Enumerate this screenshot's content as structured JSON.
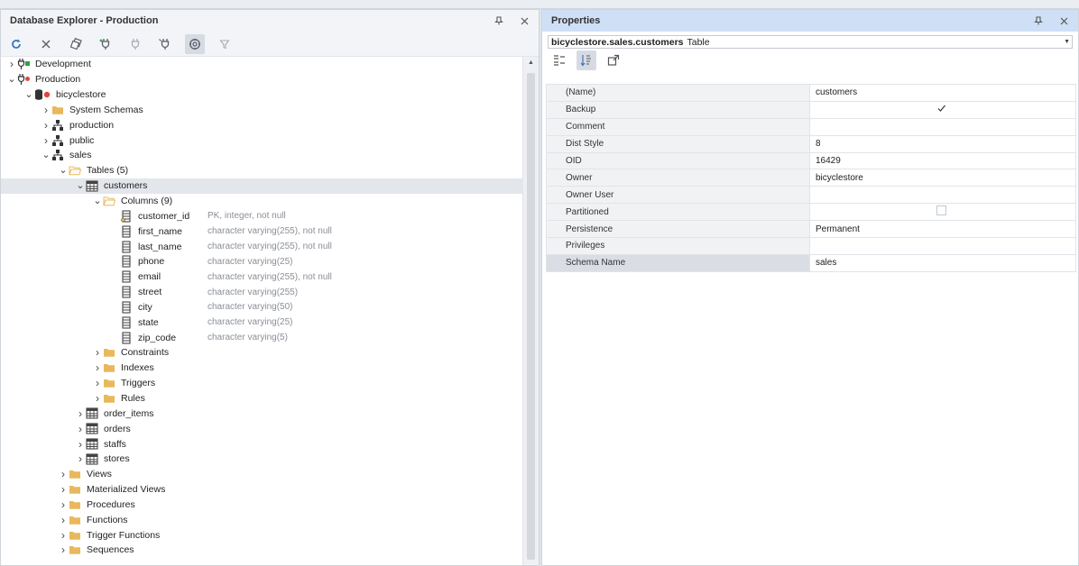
{
  "explorer": {
    "title": "Database Explorer - Production",
    "tree": [
      {
        "label": "Development",
        "icon": "connection-dev-icon",
        "depth": 0,
        "arrow": "right"
      },
      {
        "label": "Production",
        "icon": "connection-prod-icon",
        "depth": 0,
        "arrow": "down"
      },
      {
        "label": "bicyclestore",
        "icon": "database-icon",
        "depth": 1,
        "arrow": "down"
      },
      {
        "label": "System Schemas",
        "icon": "folder-icon",
        "depth": 2,
        "arrow": "right"
      },
      {
        "label": "production",
        "icon": "schema-icon",
        "depth": 2,
        "arrow": "right"
      },
      {
        "label": "public",
        "icon": "schema-icon",
        "depth": 2,
        "arrow": "right"
      },
      {
        "label": "sales",
        "icon": "schema-icon",
        "depth": 2,
        "arrow": "down"
      },
      {
        "label": "Tables (5)",
        "icon": "folder-open-icon",
        "depth": 3,
        "arrow": "down"
      },
      {
        "label": "customers",
        "icon": "table-icon",
        "depth": 4,
        "arrow": "down",
        "selected": true
      },
      {
        "label": "Columns (9)",
        "icon": "folder-open-icon",
        "depth": 5,
        "arrow": "down"
      },
      {
        "label": "customer_id",
        "icon": "pk-column-icon",
        "depth": 6,
        "meta": "PK, integer, not null"
      },
      {
        "label": "first_name",
        "icon": "column-icon",
        "depth": 6,
        "meta": "character varying(255), not null"
      },
      {
        "label": "last_name",
        "icon": "column-icon",
        "depth": 6,
        "meta": "character varying(255), not null"
      },
      {
        "label": "phone",
        "icon": "column-icon",
        "depth": 6,
        "meta": "character varying(25)"
      },
      {
        "label": "email",
        "icon": "column-icon",
        "depth": 6,
        "meta": "character varying(255), not null"
      },
      {
        "label": "street",
        "icon": "column-icon",
        "depth": 6,
        "meta": "character varying(255)"
      },
      {
        "label": "city",
        "icon": "column-icon",
        "depth": 6,
        "meta": "character varying(50)"
      },
      {
        "label": "state",
        "icon": "column-icon",
        "depth": 6,
        "meta": "character varying(25)"
      },
      {
        "label": "zip_code",
        "icon": "column-icon",
        "depth": 6,
        "meta": "character varying(5)"
      },
      {
        "label": "Constraints",
        "icon": "folder-icon",
        "depth": 5,
        "arrow": "right"
      },
      {
        "label": "Indexes",
        "icon": "folder-icon",
        "depth": 5,
        "arrow": "right"
      },
      {
        "label": "Triggers",
        "icon": "folder-icon",
        "depth": 5,
        "arrow": "right"
      },
      {
        "label": "Rules",
        "icon": "folder-icon",
        "depth": 5,
        "arrow": "right"
      },
      {
        "label": "order_items",
        "icon": "table-icon",
        "depth": 4,
        "arrow": "right"
      },
      {
        "label": "orders",
        "icon": "table-icon",
        "depth": 4,
        "arrow": "right"
      },
      {
        "label": "staffs",
        "icon": "table-icon",
        "depth": 4,
        "arrow": "right"
      },
      {
        "label": "stores",
        "icon": "table-icon",
        "depth": 4,
        "arrow": "right"
      },
      {
        "label": "Views",
        "icon": "folder-icon",
        "depth": 3,
        "arrow": "right"
      },
      {
        "label": "Materialized Views",
        "icon": "folder-icon",
        "depth": 3,
        "arrow": "right"
      },
      {
        "label": "Procedures",
        "icon": "folder-icon",
        "depth": 3,
        "arrow": "right"
      },
      {
        "label": "Functions",
        "icon": "folder-icon",
        "depth": 3,
        "arrow": "right"
      },
      {
        "label": "Trigger Functions",
        "icon": "folder-icon",
        "depth": 3,
        "arrow": "right"
      },
      {
        "label": "Sequences",
        "icon": "folder-icon",
        "depth": 3,
        "arrow": "right"
      }
    ]
  },
  "properties": {
    "title": "Properties",
    "object_name": "bicyclestore.sales.customers",
    "object_type": "Table",
    "rows": [
      {
        "name": "(Name)",
        "value": "customers"
      },
      {
        "name": "Backup",
        "value": "",
        "check": "checked"
      },
      {
        "name": "Comment",
        "value": ""
      },
      {
        "name": "Dist Style",
        "value": "8"
      },
      {
        "name": "OID",
        "value": "16429"
      },
      {
        "name": "Owner",
        "value": "bicyclestore"
      },
      {
        "name": "Owner User",
        "value": ""
      },
      {
        "name": "Partitioned",
        "value": "",
        "check": "unchecked"
      },
      {
        "name": "Persistence",
        "value": "Permanent"
      },
      {
        "name": "Privileges",
        "value": ""
      },
      {
        "name": "Schema Name",
        "value": "sales",
        "selected": true
      }
    ]
  },
  "colors": {
    "folder": "#e9b85c",
    "green": "#2ea043",
    "red": "#e0463a",
    "accent_title": "#cfe0f6"
  }
}
